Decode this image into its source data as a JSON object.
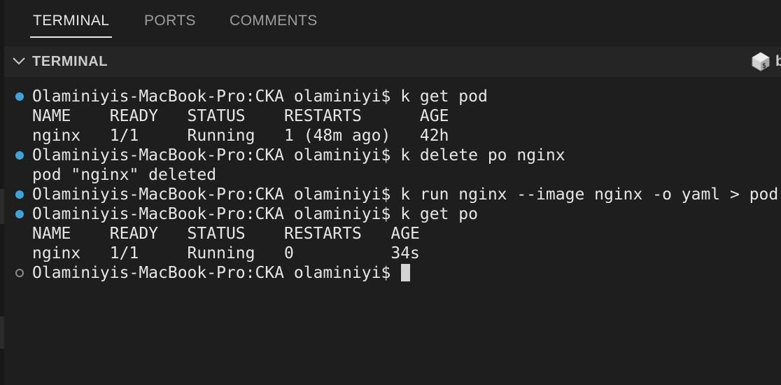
{
  "tabs": [
    {
      "label": "TERMINAL",
      "active": true
    },
    {
      "label": "PORTS",
      "active": false
    },
    {
      "label": "COMMENTS",
      "active": false
    }
  ],
  "section": {
    "title": "TERMINAL",
    "shell_label": "b"
  },
  "terminal": {
    "lines": [
      {
        "text": "Olaminiyis-MacBook-Pro:CKA olaminiyi$ k get pod",
        "marker": "success"
      },
      {
        "text": "NAME    READY   STATUS    RESTARTS      AGE",
        "marker": "none"
      },
      {
        "text": "nginx   1/1     Running   1 (48m ago)   42h",
        "marker": "none"
      },
      {
        "text": "Olaminiyis-MacBook-Pro:CKA olaminiyi$ k delete po nginx",
        "marker": "success"
      },
      {
        "text": "pod \"nginx\" deleted",
        "marker": "none"
      },
      {
        "text": "Olaminiyis-MacBook-Pro:CKA olaminiyi$ k run nginx --image nginx -o yaml > pod",
        "marker": "success"
      },
      {
        "text": "Olaminiyis-MacBook-Pro:CKA olaminiyi$ k get po",
        "marker": "success"
      },
      {
        "text": "NAME    READY   STATUS    RESTARTS   AGE",
        "marker": "none"
      },
      {
        "text": "nginx   1/1     Running   0          34s",
        "marker": "none"
      },
      {
        "text": "Olaminiyis-MacBook-Pro:CKA olaminiyi$ ",
        "marker": "pending"
      }
    ]
  },
  "colors": {
    "background": "#1e1e1e",
    "header_background": "#252526",
    "success_marker": "#3fa3d6",
    "pending_marker": "#8a8a8a"
  }
}
